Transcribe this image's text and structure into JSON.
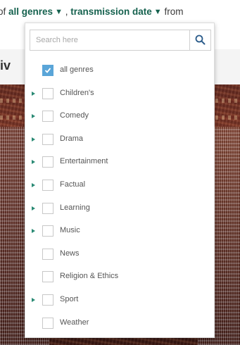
{
  "header": {
    "prefix": "of",
    "genre_filter": "all genres",
    "separator": ",",
    "date_filter": "transmission date",
    "suffix": "from"
  },
  "page_heading_partial": "iv",
  "genre_dropdown": {
    "search_placeholder": "Search here",
    "search_value": "",
    "items": [
      {
        "label": "all genres",
        "checked": true,
        "expandable": false
      },
      {
        "label": "Children's",
        "checked": false,
        "expandable": true
      },
      {
        "label": "Comedy",
        "checked": false,
        "expandable": true
      },
      {
        "label": "Drama",
        "checked": false,
        "expandable": true
      },
      {
        "label": "Entertainment",
        "checked": false,
        "expandable": true
      },
      {
        "label": "Factual",
        "checked": false,
        "expandable": true
      },
      {
        "label": "Learning",
        "checked": false,
        "expandable": true
      },
      {
        "label": "Music",
        "checked": false,
        "expandable": true
      },
      {
        "label": "News",
        "checked": false,
        "expandable": false
      },
      {
        "label": "Religion & Ethics",
        "checked": false,
        "expandable": false
      },
      {
        "label": "Sport",
        "checked": false,
        "expandable": true
      },
      {
        "label": "Weather",
        "checked": false,
        "expandable": false
      }
    ]
  },
  "icons": {
    "search": "search-icon",
    "expand": "caret-right-icon",
    "check": "check-icon",
    "dropdown": "chevron-down-icon"
  },
  "colors": {
    "link": "#16624f",
    "checkbox_checked": "#5aa5d8",
    "expand_arrow": "#2a8a74"
  }
}
